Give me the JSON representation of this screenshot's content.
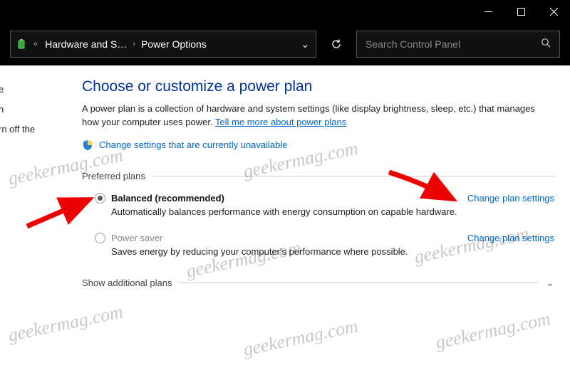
{
  "titlebar": {
    "min": "–",
    "max": "☐",
    "close": "✕"
  },
  "toolbar": {
    "crumb1": "Hardware and S…",
    "crumb2": "Power Options",
    "search_placeholder": "Search Control Panel"
  },
  "left_fragments": [
    "e",
    "n",
    "rn off the"
  ],
  "page": {
    "heading": "Choose or customize a power plan",
    "desc": "A power plan is a collection of hardware and system settings (like display brightness, sleep, etc.) that manages how your computer uses power. ",
    "learn_more": "Tell me more about power plans",
    "change_unavailable": "Change settings that are currently unavailable",
    "preferred_label": "Preferred plans",
    "additional_label": "Show additional plans"
  },
  "plans": {
    "balanced": {
      "name": "Balanced (recommended)",
      "desc": "Automatically balances performance with energy consumption on capable hardware.",
      "change": "Change plan settings"
    },
    "saver": {
      "name": "Power saver",
      "desc": "Saves energy by reducing your computer's performance where possible.",
      "change": "Change plan settings"
    }
  },
  "watermark": "geekermag.com"
}
